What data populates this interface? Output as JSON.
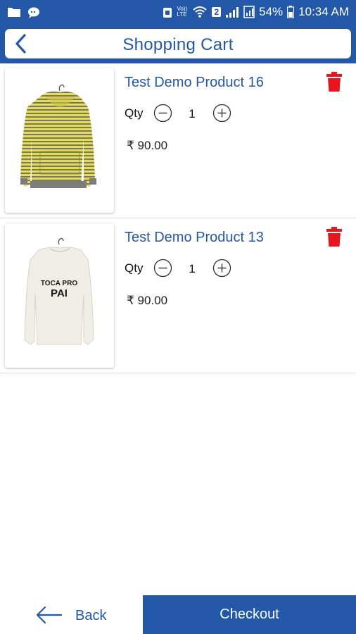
{
  "status_bar": {
    "battery": "54%",
    "time": "10:34 AM",
    "network_label": "Vo)) LTE",
    "sim_badge": "2"
  },
  "header": {
    "title": "Shopping Cart"
  },
  "cart": {
    "items": [
      {
        "name": "Test Demo Product 16",
        "qty_label": "Qty",
        "qty": "1",
        "price": "₹ 90.00",
        "image": "yellow-striped-hoodie"
      },
      {
        "name": "Test Demo Product 13",
        "qty_label": "Qty",
        "qty": "1",
        "price": "₹ 90.00",
        "image": "white-sweatshirt",
        "image_text_line1": "TOCA PRO",
        "image_text_line2": "PAI"
      }
    ]
  },
  "footer": {
    "back_label": "Back",
    "checkout_label": "Checkout"
  },
  "colors": {
    "brand": "#2358a8",
    "delete": "#e8161c"
  }
}
